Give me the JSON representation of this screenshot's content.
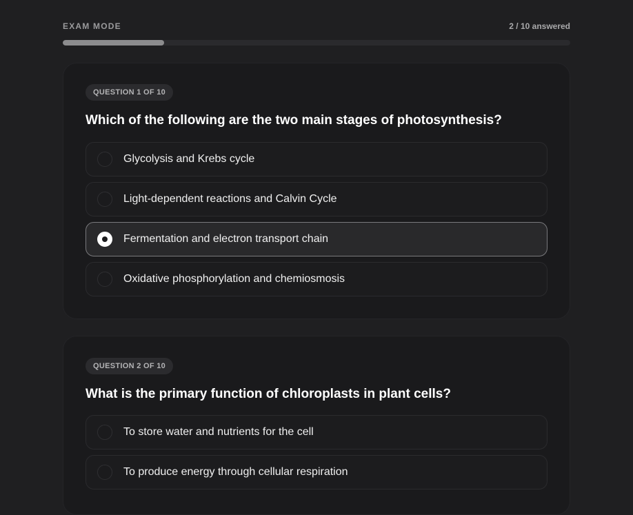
{
  "header": {
    "mode_label": "EXAM MODE",
    "answered_text": "2 / 10 answered",
    "progress_fraction": 0.2
  },
  "questions": [
    {
      "badge": "QUESTION 1 OF 10",
      "text": "Which of the following are the two main stages of photosynthesis?",
      "selected_index": 2,
      "options": [
        {
          "label": "Glycolysis and Krebs cycle"
        },
        {
          "label": "Light-dependent reactions and Calvin Cycle"
        },
        {
          "label": "Fermentation and electron transport chain"
        },
        {
          "label": "Oxidative phosphorylation and chemiosmosis"
        }
      ]
    },
    {
      "badge": "QUESTION 2 OF 10",
      "text": "What is the primary function of chloroplasts in plant cells?",
      "selected_index": -1,
      "options": [
        {
          "label": "To store water and nutrients for the cell"
        },
        {
          "label": "To produce energy through cellular respiration"
        }
      ]
    }
  ]
}
